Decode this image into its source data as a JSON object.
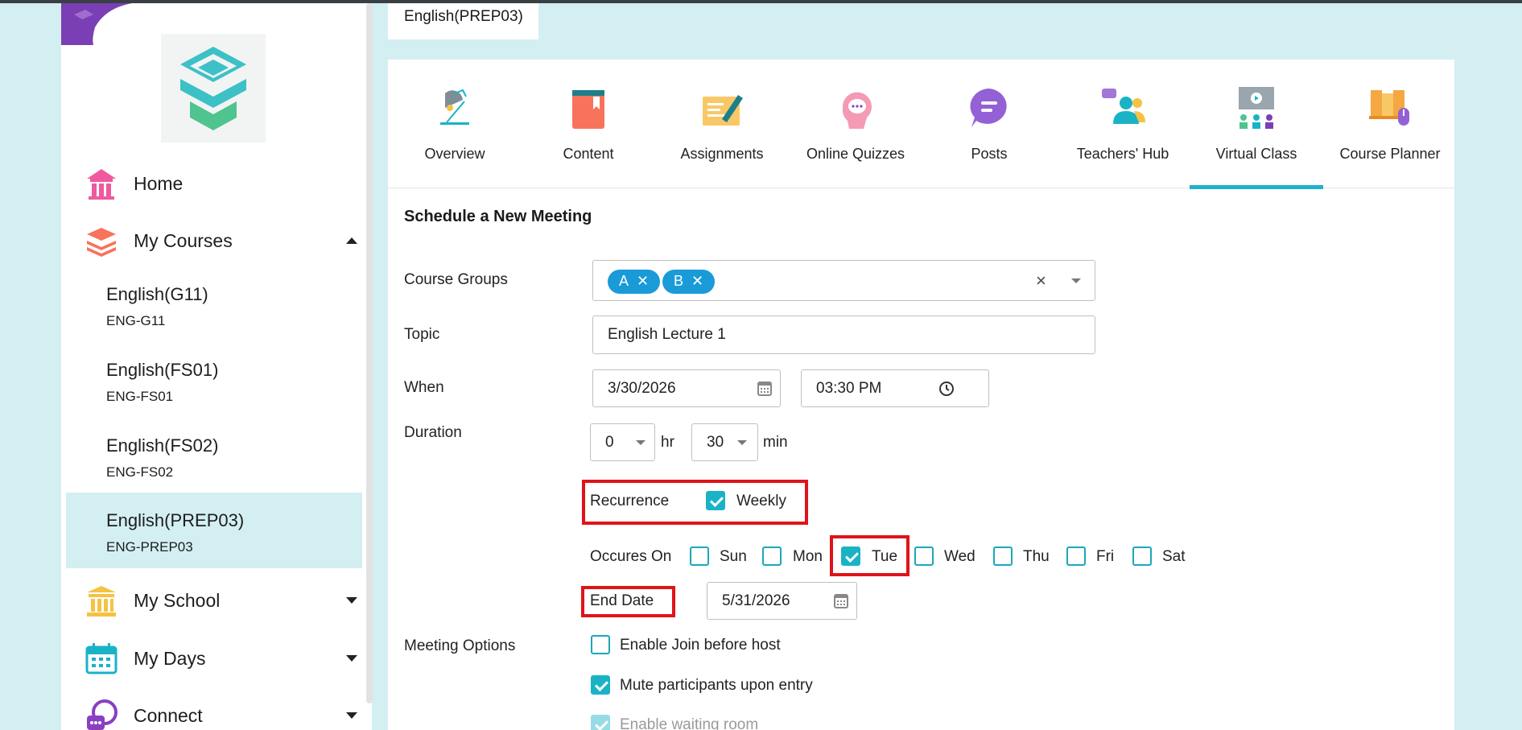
{
  "breadcrumb": "English(PREP03)",
  "sidebar": {
    "nav": [
      {
        "label": "Home",
        "icon": "home-icon"
      },
      {
        "label": "My Courses",
        "icon": "courses-icon"
      },
      {
        "label": "My School",
        "icon": "school-icon"
      },
      {
        "label": "My Days",
        "icon": "calendar-icon"
      },
      {
        "label": "Connect",
        "icon": "connect-icon"
      }
    ],
    "courses": [
      {
        "name": "English(G11)",
        "code": "ENG-G11"
      },
      {
        "name": "English(FS01)",
        "code": "ENG-FS01"
      },
      {
        "name": "English(FS02)",
        "code": "ENG-FS02"
      },
      {
        "name": "English(PREP03)",
        "code": "ENG-PREP03"
      }
    ]
  },
  "tabs": [
    {
      "label": "Overview",
      "icon": "overview-icon"
    },
    {
      "label": "Content",
      "icon": "book-icon"
    },
    {
      "label": "Assignments",
      "icon": "assignment-icon"
    },
    {
      "label": "Online Quizzes",
      "icon": "quiz-icon"
    },
    {
      "label": "Posts",
      "icon": "posts-icon"
    },
    {
      "label": "Teachers' Hub",
      "icon": "teachers-hub-icon"
    },
    {
      "label": "Virtual Class",
      "icon": "virtual-class-icon"
    },
    {
      "label": "Course Planner",
      "icon": "course-planner-icon"
    }
  ],
  "form": {
    "title": "Schedule a New Meeting",
    "course_groups_label": "Course Groups",
    "groups": [
      "A",
      "B"
    ],
    "chip_remove": "✕",
    "clear": "×",
    "topic_label": "Topic",
    "topic_value": "English Lecture 1",
    "when_label": "When",
    "date_value": "3/30/2026",
    "time_value": "03:30 PM",
    "duration_label": "Duration",
    "hours_value": "0",
    "hr_unit": "hr",
    "minutes_value": "30",
    "min_unit": "min",
    "recurrence_label": "Recurrence",
    "weekly_label": "Weekly",
    "occurs_on_label": "Occures On",
    "days": [
      "Sun",
      "Mon",
      "Tue",
      "Wed",
      "Thu",
      "Fri",
      "Sat"
    ],
    "end_date_label": "End Date",
    "end_date_value": "5/31/2026",
    "meeting_options_label": "Meeting Options",
    "options": [
      {
        "label": "Enable Join before host",
        "checked": false
      },
      {
        "label": "Mute participants upon entry",
        "checked": true
      },
      {
        "label": "Enable waiting room",
        "checked": true
      }
    ]
  },
  "colors": {
    "accent": "#1ab3c6",
    "highlight": "#e0131b",
    "chip": "#1a9bd8",
    "background": "#d3eff2"
  }
}
